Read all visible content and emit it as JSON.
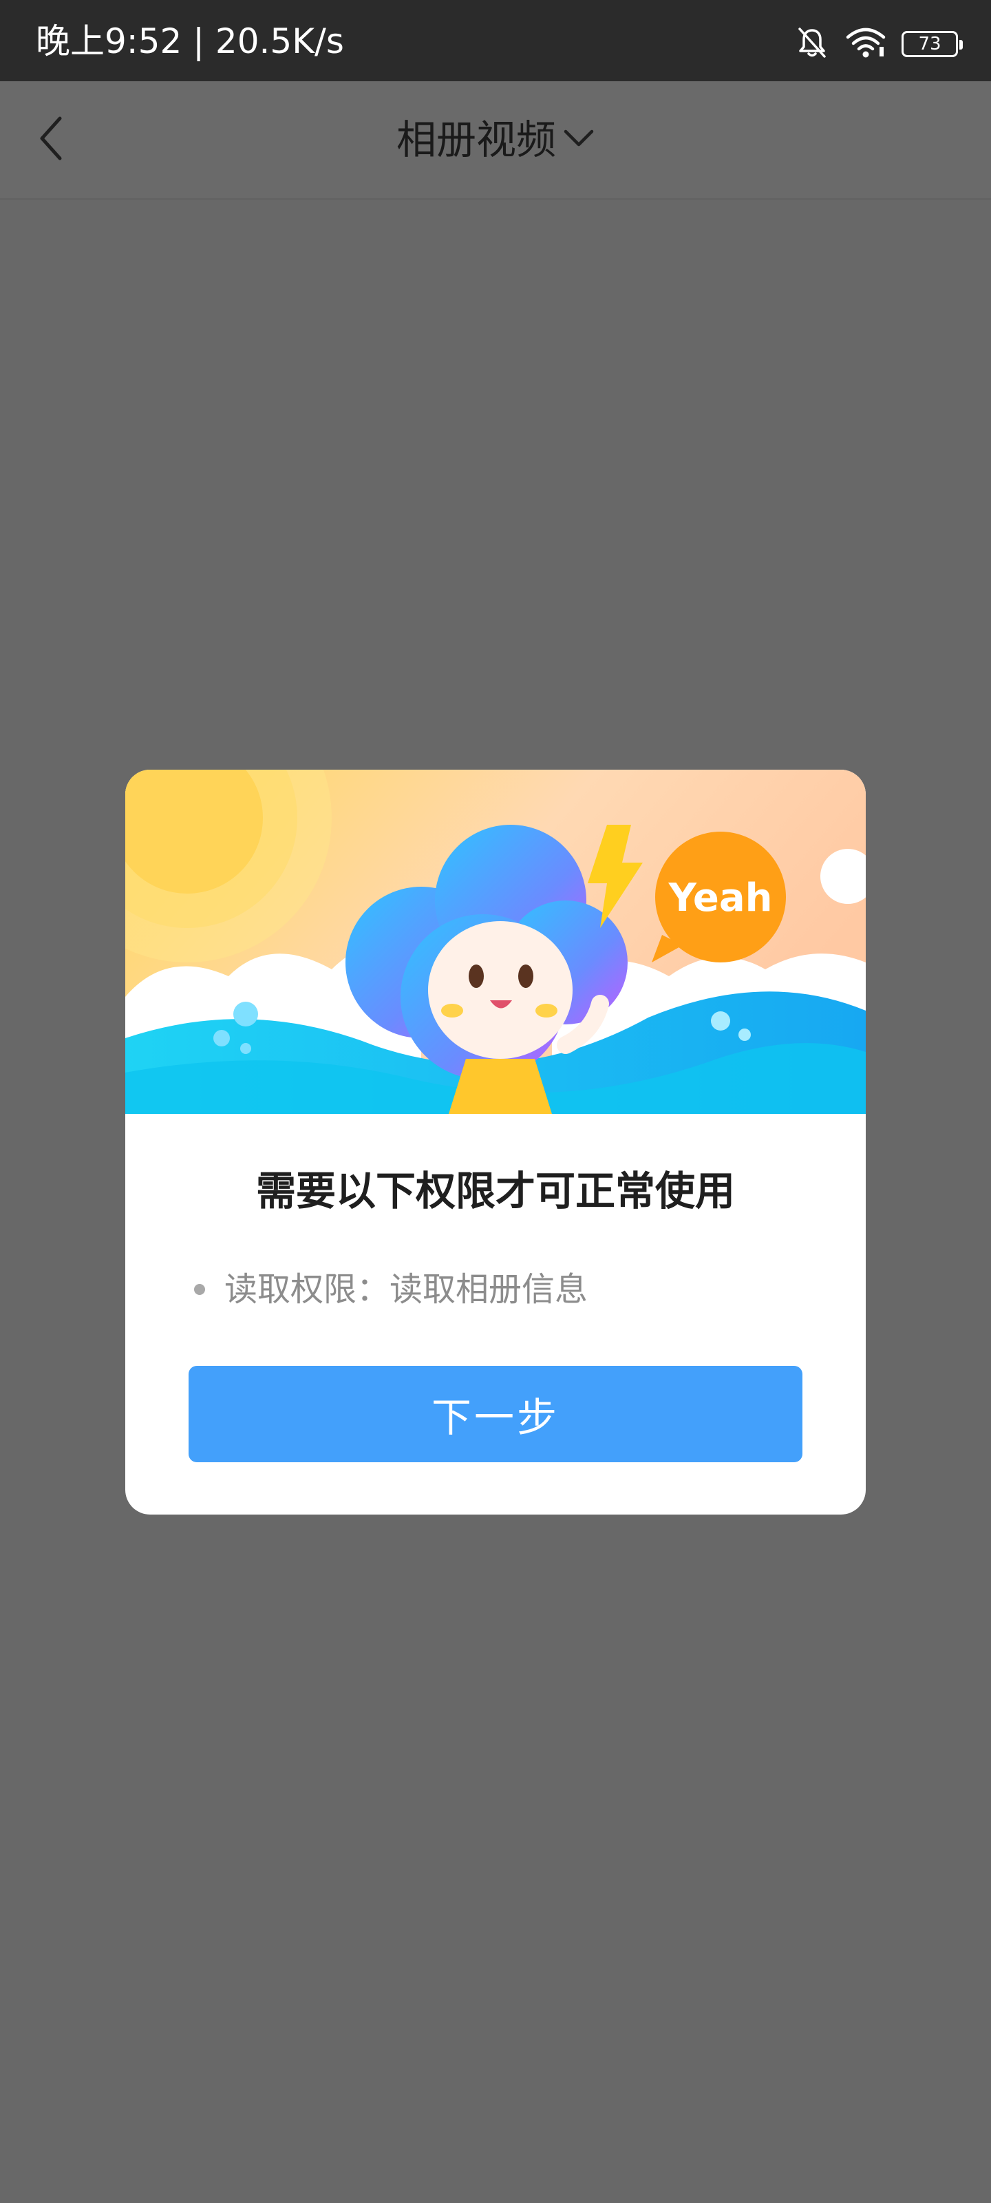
{
  "status_bar": {
    "text": "晚上9:52 | 20.5K/s",
    "battery_level": "73"
  },
  "nav": {
    "title": "相册视频"
  },
  "dialog": {
    "title": "需要以下权限才可正常使用",
    "permission_text": "读取权限：读取相册信息",
    "next_button_label": "下一步",
    "banner_speech": "Yeah"
  },
  "colors": {
    "overlay": "#686868",
    "status_bar_bg": "#2b2b2b",
    "primary_button": "#43a0fb",
    "dialog_bg": "#ffffff"
  },
  "icons": {
    "back": "chevron-left-icon",
    "title_dropdown": "chevron-down-icon",
    "mute": "bell-off-icon",
    "wifi": "wifi-icon",
    "battery": "battery-icon"
  }
}
